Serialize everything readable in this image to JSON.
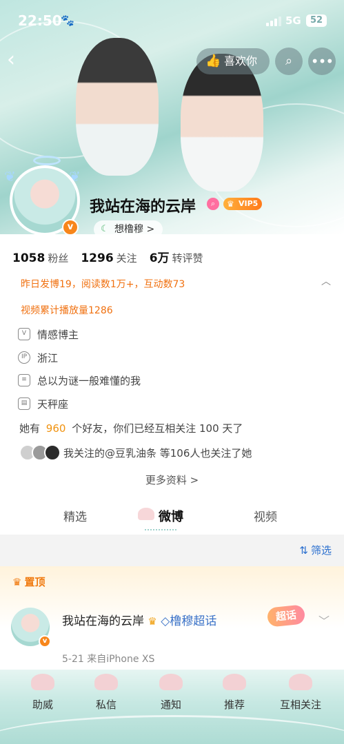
{
  "status_bar": {
    "time": "22:50",
    "network": "5G",
    "battery": "52"
  },
  "header": {
    "like_label": "喜欢你"
  },
  "profile": {
    "name": "我站在海的云岸",
    "vip_label": "VIP5",
    "tag_label": "想橹穆 >",
    "stats": [
      {
        "value": "1058",
        "label": "粉丝"
      },
      {
        "value": "1296",
        "label": "关注"
      },
      {
        "value": "6万",
        "label": "转评赞"
      }
    ],
    "activity_line": "昨日发博19，阅读数1万+，互动数73",
    "video_line": "视频累计播放量1286",
    "info": {
      "category": "情感博主",
      "location": "浙江",
      "bio": "总以为谜一般难懂的我",
      "constellation": "天秤座"
    },
    "friends": {
      "prefix": "她有",
      "count": "960",
      "suffix": "个好友，你们已经互相关注 100 天了"
    },
    "mutual_follow": "我关注的@豆乳油条 等106人也关注了她",
    "more_label": "更多资料 >"
  },
  "tabs": [
    "精选",
    "微博",
    "视频"
  ],
  "filter_label": "筛选",
  "pinned": {
    "label": "置顶",
    "post_name": "我站在海的云岸",
    "post_topic": "橹穆超话",
    "chaohua_label": "超话",
    "meta": "5-21  来自iPhone XS"
  },
  "bottom_bar": [
    "助威",
    "私信",
    "通知",
    "推荐",
    "互相关注"
  ],
  "colors": {
    "orange": "#f0700f",
    "link_blue": "#2a6fcf",
    "teal": "#aedcd4"
  }
}
